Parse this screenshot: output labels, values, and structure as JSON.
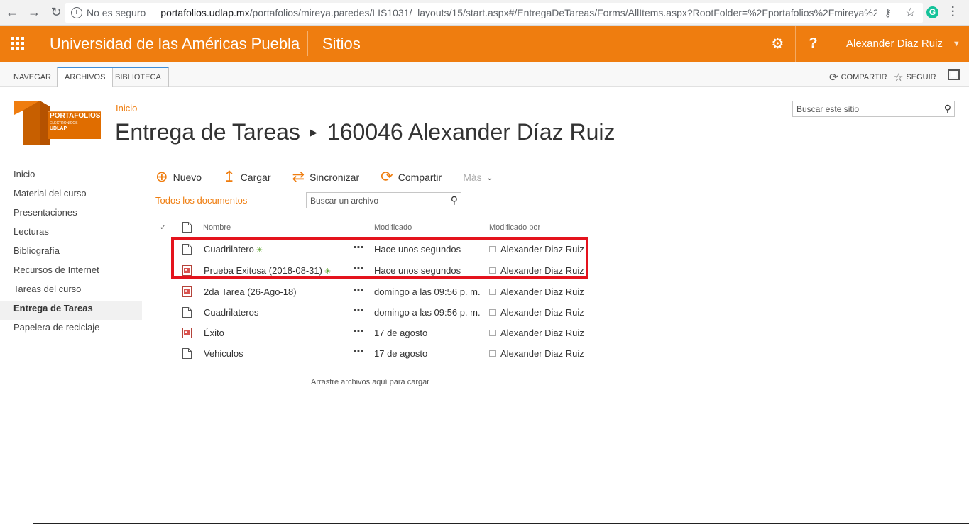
{
  "browser": {
    "security_label": "No es seguro",
    "url_host": "portafolios.udlap.mx",
    "url_path": "/portafolios/mireya.paredes/LIS1031/_layouts/15/start.aspx#/EntregaDeTareas/Forms/AllItems.aspx?RootFolder=%2Fportafolios%2Fmireya%2E...",
    "extension_letter": "G"
  },
  "suite": {
    "brand": "Universidad de las Américas Puebla",
    "sites": "Sitios",
    "help": "?",
    "user_name": "Alexander Diaz Ruiz"
  },
  "ribbon": {
    "tabs": [
      "NAVEGAR",
      "ARCHIVOS",
      "BIBLIOTECA"
    ],
    "share": "COMPARTIR",
    "follow": "SEGUIR"
  },
  "logo": {
    "line1": "PORTAFOLIOS",
    "line2": "ELECTRÓNICOS",
    "line3": "UDLAP"
  },
  "breadcrumb": {
    "home": "Inicio"
  },
  "title": {
    "library": "Entrega de Tareas",
    "folder": "160046 Alexander Díaz Ruiz"
  },
  "site_search": {
    "placeholder": "Buscar este sitio"
  },
  "left_nav": [
    "Inicio",
    "Material del curso",
    "Presentaciones",
    "Lecturas",
    "Bibliografía",
    "Recursos de Internet",
    "Tareas del curso",
    "Entrega de Tareas",
    "Papelera de reciclaje"
  ],
  "commands": {
    "new": "Nuevo",
    "upload": "Cargar",
    "sync": "Sincronizar",
    "share": "Compartir",
    "more": "Más"
  },
  "view": {
    "name": "Todos los documentos",
    "search_placeholder": "Buscar un archivo"
  },
  "table": {
    "headers": {
      "name": "Nombre",
      "modified": "Modificado",
      "modified_by": "Modificado por"
    },
    "rows": [
      {
        "name": "Cuadrilatero",
        "is_new": true,
        "type": "doc",
        "modified": "Hace unos segundos",
        "modified_by": "Alexander Diaz Ruiz"
      },
      {
        "name": "Prueba Exitosa (2018-08-31)",
        "is_new": true,
        "type": "img",
        "modified": "Hace unos segundos",
        "modified_by": "Alexander Diaz Ruiz"
      },
      {
        "name": "2da Tarea (26-Ago-18)",
        "is_new": false,
        "type": "img",
        "modified": "domingo a las 09:56 p. m.",
        "modified_by": "Alexander Diaz Ruiz"
      },
      {
        "name": "Cuadrilateros",
        "is_new": false,
        "type": "doc",
        "modified": "domingo a las 09:56 p. m.",
        "modified_by": "Alexander Diaz Ruiz"
      },
      {
        "name": "Éxito",
        "is_new": false,
        "type": "img",
        "modified": "17 de agosto",
        "modified_by": "Alexander Diaz Ruiz"
      },
      {
        "name": "Vehiculos",
        "is_new": false,
        "type": "doc",
        "modified": "17 de agosto",
        "modified_by": "Alexander Diaz Ruiz"
      }
    ]
  },
  "drop_hint": "Arrastre archivos aquí para cargar",
  "colors": {
    "accent": "#ef7d0f",
    "highlight": "#e4131d",
    "ribbon_tab": "#3d8ed8"
  }
}
